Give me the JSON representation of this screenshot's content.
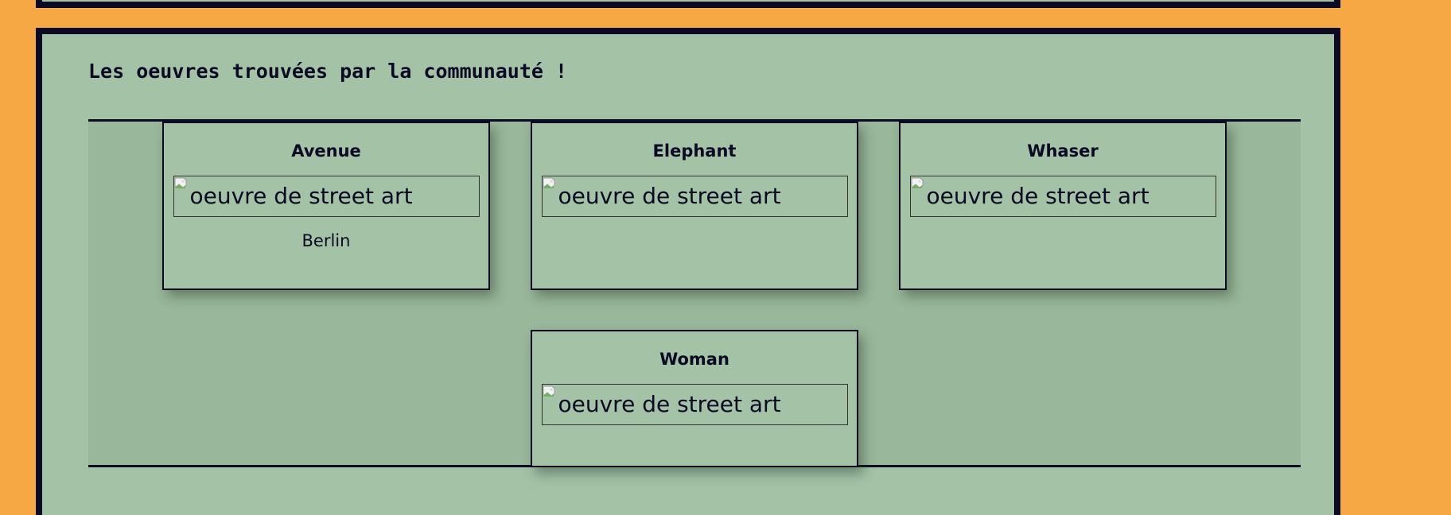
{
  "section": {
    "title": "Les oeuvres trouvées par la communauté !"
  },
  "artworks": [
    {
      "title": "Avenue",
      "image_alt": "oeuvre de street art",
      "city": "Berlin"
    },
    {
      "title": "Elephant",
      "image_alt": "oeuvre de street art",
      "city": ""
    },
    {
      "title": "Whaser",
      "image_alt": "oeuvre de street art",
      "city": ""
    },
    {
      "title": "Woman",
      "image_alt": "oeuvre de street art",
      "city": ""
    }
  ],
  "colors": {
    "page_background": "#f5a843",
    "panel_background": "#a3c2a6",
    "gallery_background": "#99b79a",
    "border": "#0a0a24"
  },
  "icons": {
    "image_placeholder": "broken-image-icon"
  }
}
